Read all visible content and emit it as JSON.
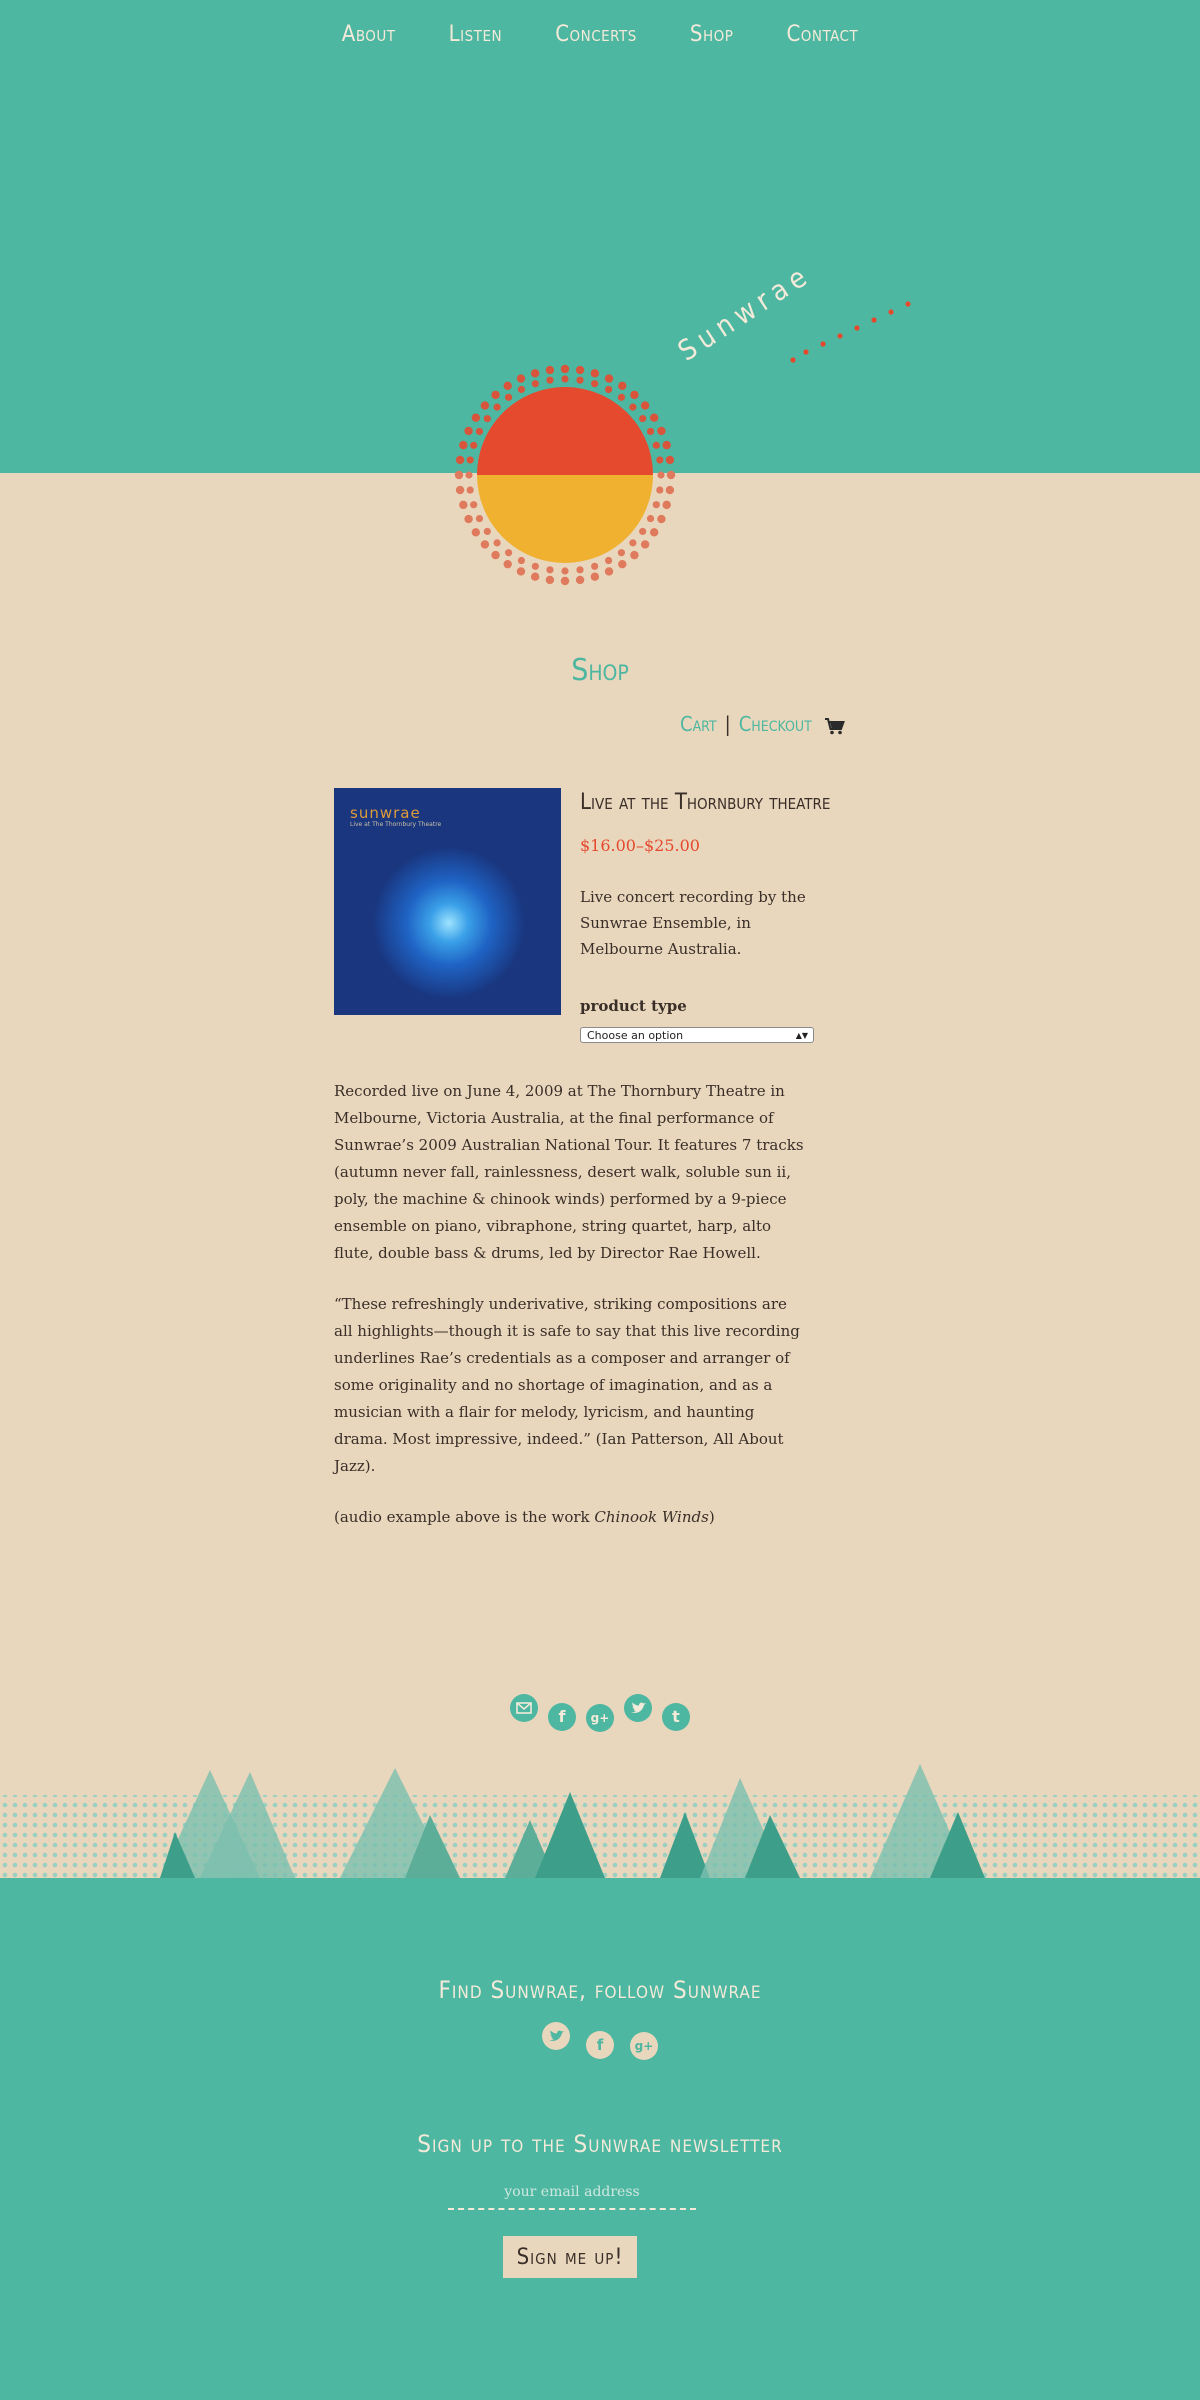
{
  "nav": {
    "items": [
      "About",
      "Listen",
      "Concerts",
      "Shop",
      "Contact"
    ]
  },
  "brand": {
    "name": "Sunwrae"
  },
  "shop": {
    "title": "Shop",
    "cart": "Cart",
    "checkout": "Checkout"
  },
  "product": {
    "album_title": "sunwrae",
    "album_subtitle": "Live at The Thornbury Theatre",
    "title": "Live at the Thornbury theatre",
    "price": "$16.00–$25.00",
    "short_desc": "Live concert recording by the Sunwrae Ensemble, in Melbourne Australia.",
    "type_label": "product type",
    "select_value": "Choose an option"
  },
  "body": {
    "p1": "Recorded live on June 4, 2009 at The Thornbury Theatre in Melbourne, Victoria Australia, at the final performance of Sunwrae’s 2009 Australian National Tour. It features 7 tracks (autumn never fall, rainlessness, desert walk, soluble sun ii, poly, the machine & chinook winds) performed by a 9-piece ensemble on piano, vibraphone, string quartet, harp, alto flute, double bass & drums, led by Director Rae Howell.",
    "p2": "“These refreshingly underivative, striking compositions are all highlights—though it is safe to say that this live recording underlines Rae’s credentials as a composer and arranger of some originality and no shortage of imagination, and as a musician with a flair for melody, lyricism, and haunting drama. Most impressive, indeed.” (Ian Patterson, All About Jazz).",
    "p3_prefix": "(audio example above is the work ",
    "p3_em": "Chinook Winds",
    "p3_suffix": ")"
  },
  "share_icons": [
    "email-icon",
    "facebook-icon",
    "google-plus-icon",
    "twitter-icon",
    "tumblr-icon"
  ],
  "footer": {
    "follow_title": "Find Sunwrae, follow Sunwrae",
    "follow_icons": [
      "twitter-icon",
      "facebook-icon",
      "google-plus-icon"
    ],
    "newsletter_title": "Sign up to the Sunwrae newsletter",
    "email_placeholder": "your email address",
    "signup_label": "Sign me up!"
  },
  "colors": {
    "teal": "#4db7a1",
    "sand": "#e8d6bd",
    "red": "#e5492e",
    "orange": "#f0b130"
  }
}
